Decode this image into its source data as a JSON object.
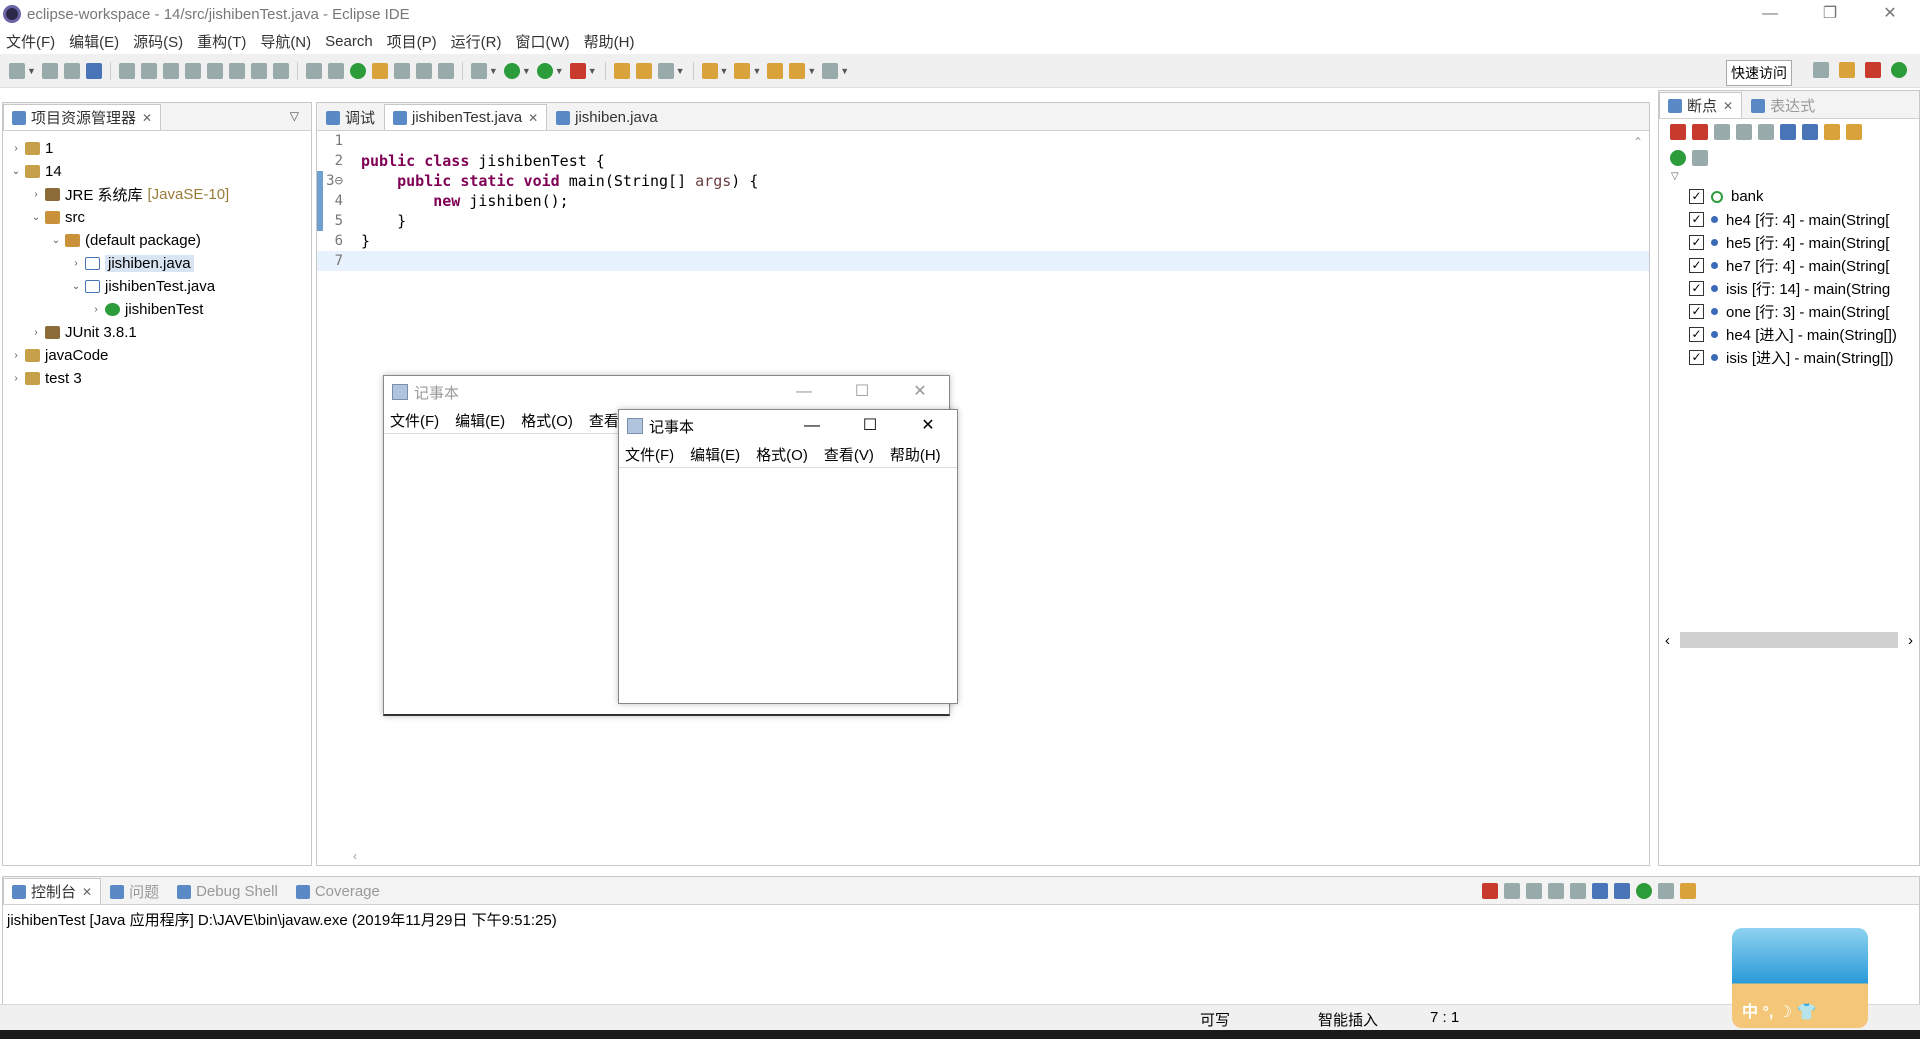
{
  "window": {
    "title": "eclipse-workspace - 14/src/jishibenTest.java - Eclipse IDE",
    "minimize": "—",
    "restore": "❐",
    "close": "✕"
  },
  "menu": [
    "文件(F)",
    "编辑(E)",
    "源码(S)",
    "重构(T)",
    "导航(N)",
    "Search",
    "项目(P)",
    "运行(R)",
    "窗口(W)",
    "帮助(H)"
  ],
  "toolbar": {
    "quick_access": "快速访问"
  },
  "explorer": {
    "tab": "项目资源管理器",
    "tree": [
      {
        "indent": 0,
        "arrow": "›",
        "icon": "proj",
        "label": "1"
      },
      {
        "indent": 0,
        "arrow": "⌄",
        "icon": "proj",
        "label": "14"
      },
      {
        "indent": 1,
        "arrow": "›",
        "icon": "lib",
        "label": "JRE 系统库",
        "extra": "[JavaSE-10]"
      },
      {
        "indent": 1,
        "arrow": "⌄",
        "icon": "pkg",
        "label": "src"
      },
      {
        "indent": 2,
        "arrow": "⌄",
        "icon": "pkg",
        "label": "(default package)"
      },
      {
        "indent": 3,
        "arrow": "›",
        "icon": "file",
        "label": "jishiben.java",
        "selected": true
      },
      {
        "indent": 3,
        "arrow": "⌄",
        "icon": "file",
        "label": "jishibenTest.java"
      },
      {
        "indent": 4,
        "arrow": "›",
        "icon": "cls",
        "label": "jishibenTest"
      },
      {
        "indent": 1,
        "arrow": "›",
        "icon": "lib",
        "label": "JUnit 3.8.1"
      },
      {
        "indent": 0,
        "arrow": "›",
        "icon": "proj",
        "label": "javaCode"
      },
      {
        "indent": 0,
        "arrow": "›",
        "icon": "proj",
        "label": "test 3"
      }
    ]
  },
  "editor": {
    "tabs": [
      {
        "label": "调试",
        "active": false
      },
      {
        "label": "jishibenTest.java",
        "active": true
      },
      {
        "label": "jishiben.java",
        "active": false
      }
    ],
    "lines": [
      {
        "n": "1",
        "tokens": []
      },
      {
        "n": "2",
        "tokens": [
          {
            "t": "public class",
            "c": "kw"
          },
          {
            "t": " jishibenTest {"
          }
        ]
      },
      {
        "n": "3⊖",
        "tokens": [
          {
            "t": "    "
          },
          {
            "t": "public static void",
            "c": "kw"
          },
          {
            "t": " main(String[] "
          },
          {
            "t": "args",
            "c": "param"
          },
          {
            "t": ") {"
          }
        ]
      },
      {
        "n": "4",
        "tokens": [
          {
            "t": "        "
          },
          {
            "t": "new",
            "c": "kw"
          },
          {
            "t": " jishiben();"
          }
        ]
      },
      {
        "n": "5",
        "tokens": [
          {
            "t": "    }"
          }
        ]
      },
      {
        "n": "6",
        "tokens": [
          {
            "t": "}"
          }
        ]
      },
      {
        "n": "7",
        "tokens": [],
        "current": true
      }
    ]
  },
  "breakpoints": {
    "tabs": [
      {
        "label": "断点",
        "active": true
      },
      {
        "label": "表达式",
        "active": false
      }
    ],
    "items": [
      {
        "label": "bank",
        "kind": "class"
      },
      {
        "label": "he4 [行:   4] - main(String["
      },
      {
        "label": "he5 [行:   4] - main(String["
      },
      {
        "label": "he7 [行:   4] - main(String["
      },
      {
        "label": "isis [行:   14] - main(String"
      },
      {
        "label": "one [行:   3] - main(String["
      },
      {
        "label": "he4 [进入] - main(String[])"
      },
      {
        "label": "isis [进入] - main(String[])"
      }
    ]
  },
  "console": {
    "tabs": [
      {
        "label": "控制台",
        "active": true
      },
      {
        "label": "问题",
        "active": false
      },
      {
        "label": "Debug Shell",
        "active": false
      },
      {
        "label": "Coverage",
        "active": false
      }
    ],
    "text": "jishibenTest [Java 应用程序] D:\\JAVE\\bin\\javaw.exe  (2019年11月29日 下午9:51:25)"
  },
  "status": {
    "writable": "可写",
    "insert_mode": "智能插入",
    "position": "7 : 1"
  },
  "notepad_back": {
    "title": "记事本",
    "menu": [
      "文件(F)",
      "编辑(E)",
      "格式(O)",
      "查看"
    ]
  },
  "notepad_front": {
    "title": "记事本",
    "menu": [
      "文件(F)",
      "编辑(E)",
      "格式(O)",
      "查看(V)",
      "帮助(H)"
    ]
  },
  "tray": {
    "text": "中 °, ☽ 👕"
  }
}
